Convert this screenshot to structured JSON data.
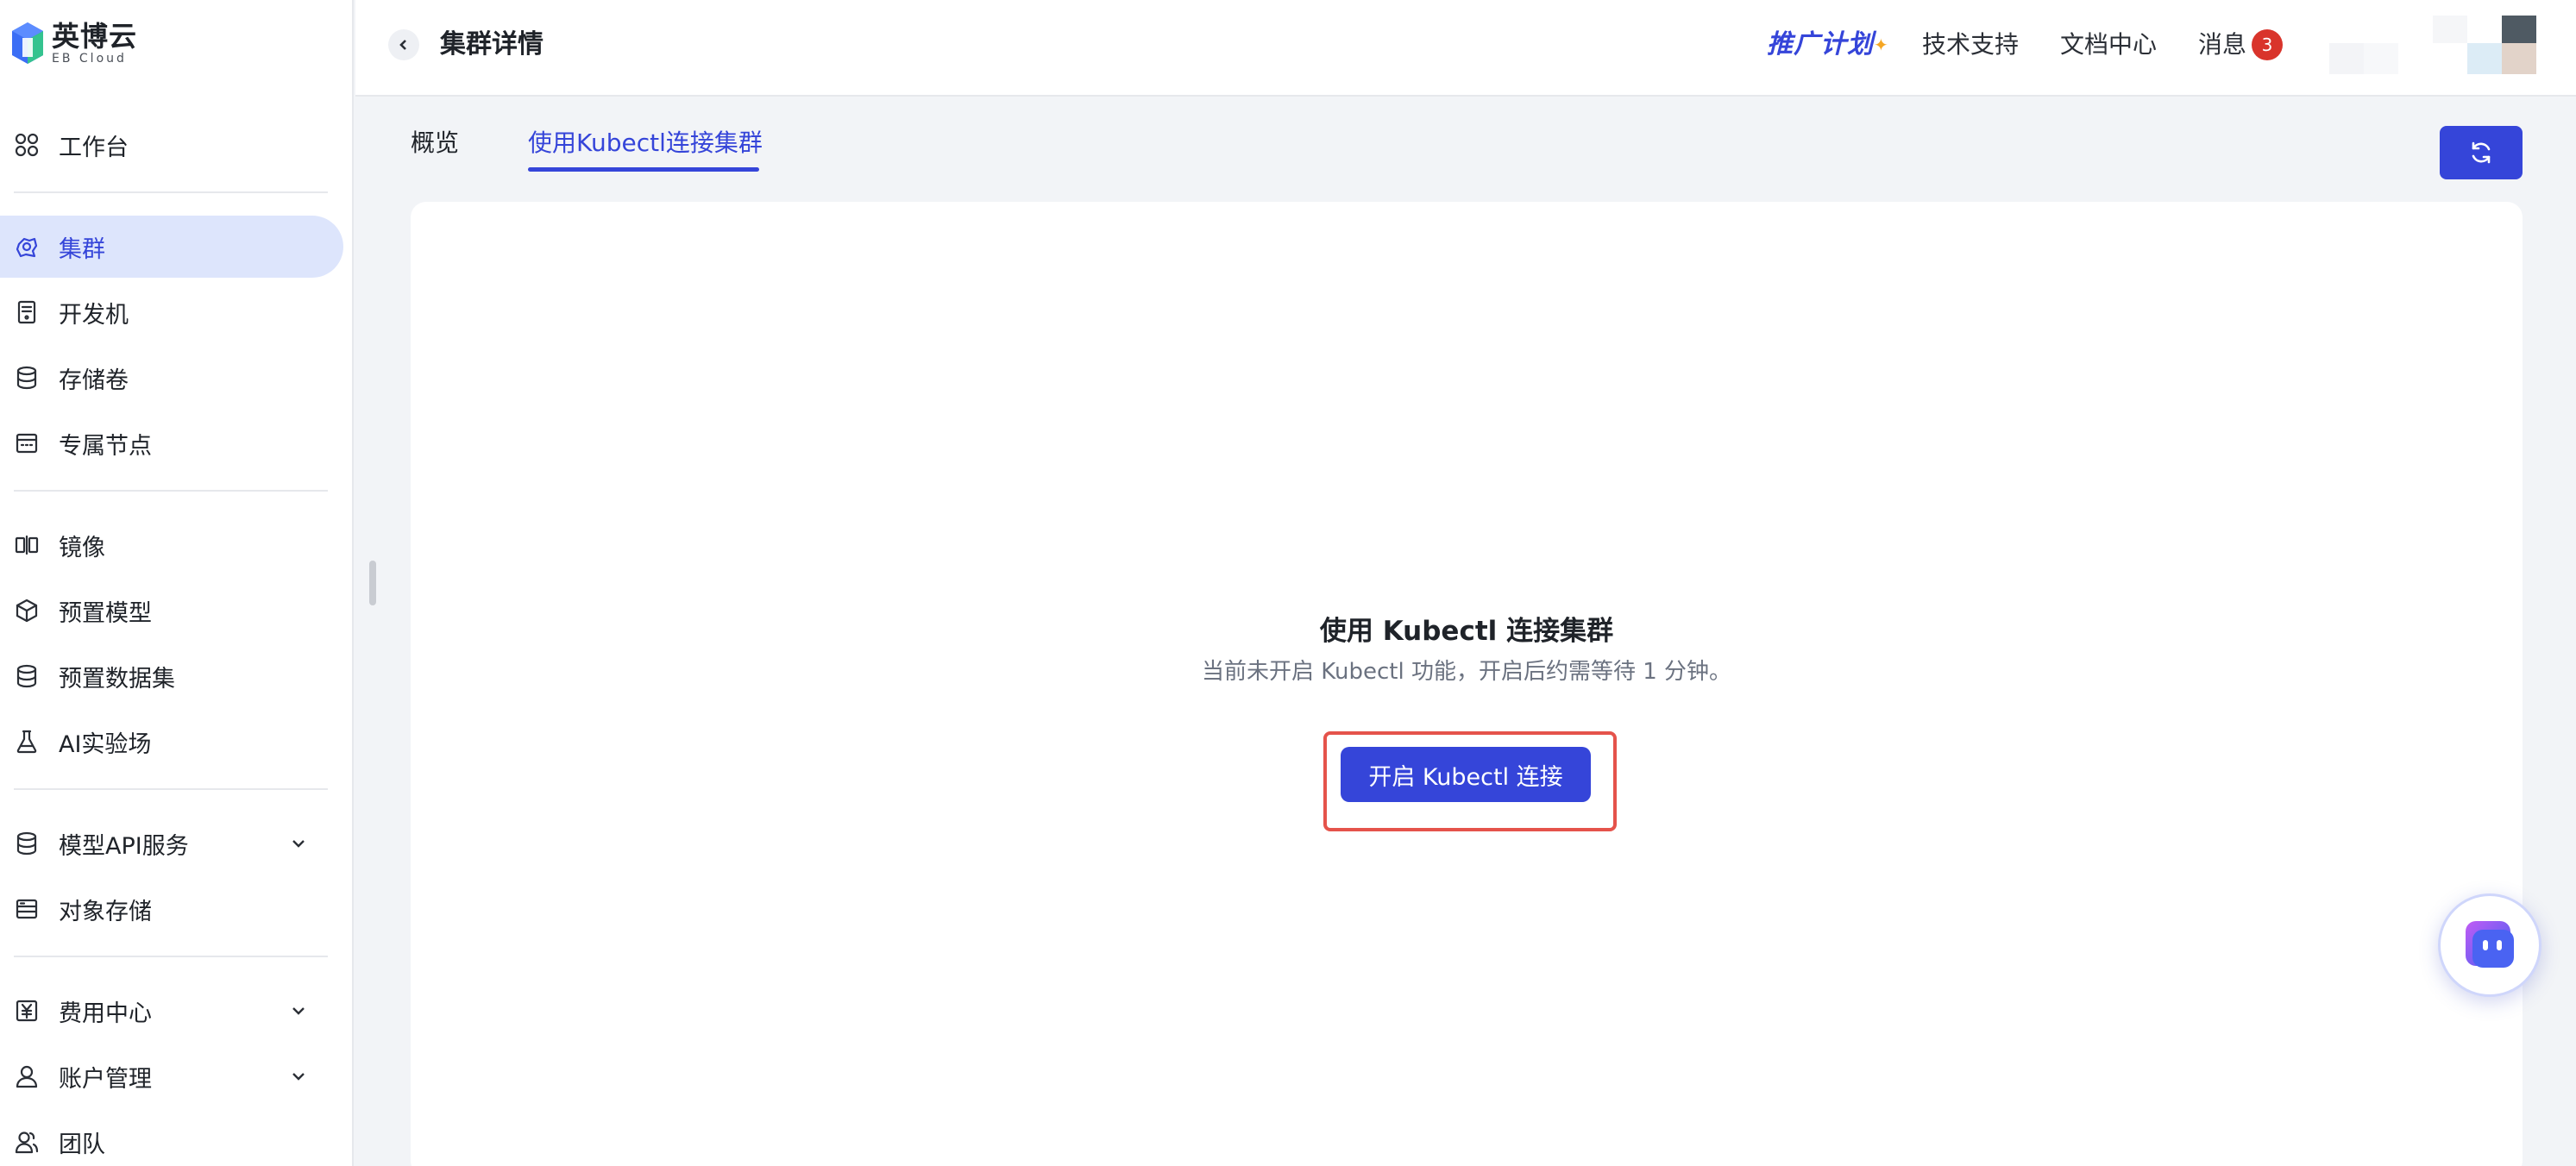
{
  "brand": {
    "name_cn": "英博云",
    "name_en": "EB Cloud",
    "colors": {
      "primary": "#3545d9",
      "logo_blue": "#3b6ef5",
      "logo_green": "#34c38f",
      "badge_red": "#d9342b",
      "highlight_red": "#e5534b"
    }
  },
  "sidebar": {
    "items": [
      {
        "label": "工作台",
        "icon": "grid-icon"
      },
      {
        "label": "集群",
        "icon": "cluster-icon",
        "active": true
      },
      {
        "label": "开发机",
        "icon": "device-icon"
      },
      {
        "label": "存储卷",
        "icon": "database-icon"
      },
      {
        "label": "专属节点",
        "icon": "node-icon"
      },
      {
        "label": "镜像",
        "icon": "mirror-icon"
      },
      {
        "label": "预置模型",
        "icon": "cube-icon"
      },
      {
        "label": "预置数据集",
        "icon": "dataset-icon"
      },
      {
        "label": "AI实验场",
        "icon": "flask-icon"
      },
      {
        "label": "模型API服务",
        "icon": "api-icon",
        "expandable": true
      },
      {
        "label": "对象存储",
        "icon": "bucket-icon"
      },
      {
        "label": "费用中心",
        "icon": "yen-icon",
        "expandable": true
      },
      {
        "label": "账户管理",
        "icon": "user-icon",
        "expandable": true
      },
      {
        "label": "团队",
        "icon": "team-icon"
      }
    ]
  },
  "header": {
    "title": "集群详情",
    "promo": "推广计划",
    "links": [
      "技术支持",
      "文档中心",
      "消息"
    ],
    "message_count": "3"
  },
  "tabs": [
    {
      "label": "概览",
      "active": false
    },
    {
      "label": "使用Kubectl连接集群",
      "active": true
    }
  ],
  "main": {
    "empty_title": "使用 Kubectl 连接集群",
    "empty_desc": "当前未开启 Kubectl 功能，开启后约需等待 1 分钟。",
    "enable_button": "开启 Kubectl 连接"
  }
}
